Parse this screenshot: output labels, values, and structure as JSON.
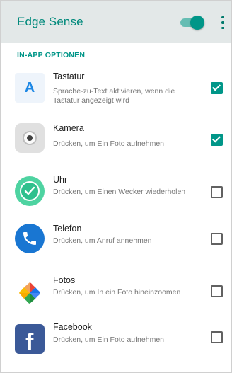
{
  "app_bar": {
    "title": "Edge Sense",
    "toggle_state": "on",
    "accent_color": "#009688",
    "overflow_icon": "more-vert-icon"
  },
  "section": {
    "header": "IN-APP OPTIONEN"
  },
  "items": [
    {
      "icon": "keyboard-icon",
      "icon_letter": "A",
      "title": "Tastatur",
      "subtitle": "Sprache-zu-Text aktivieren, wenn die Tastatur angezeigt wird",
      "checked": true
    },
    {
      "icon": "camera-icon",
      "title": "Kamera",
      "subtitle": "Drücken, um Ein Foto aufnehmen",
      "checked": true
    },
    {
      "icon": "clock-icon",
      "title": "Uhr",
      "subtitle": "Drücken, um Einen Wecker wiederholen",
      "checked": false
    },
    {
      "icon": "phone-icon",
      "title": "Telefon",
      "subtitle": "Drücken, um Anruf annehmen",
      "checked": false
    },
    {
      "icon": "photos-icon",
      "title": "Fotos",
      "subtitle": "Drücken, um In ein Foto hineinzoomen",
      "checked": false
    },
    {
      "icon": "facebook-icon",
      "icon_letter": "f",
      "title": "Facebook",
      "subtitle": "Drücken, um Ein Foto aufnehmen",
      "checked": false
    }
  ]
}
